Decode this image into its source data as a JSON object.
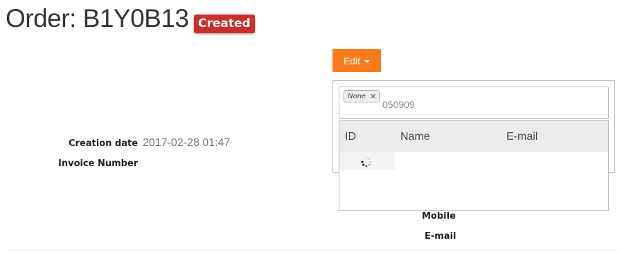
{
  "order": {
    "title": "Order: B1Y0B13",
    "status_badge": "Created",
    "status_color": "#c9302c"
  },
  "actions": {
    "edit_label": "Edit",
    "edit_color": "#f97b1d"
  },
  "customer_picker": {
    "selected_chip": "None",
    "chip_remove_icon": "close-icon",
    "search_value": "050909",
    "columns": [
      "ID",
      "Name",
      "E-mail"
    ],
    "loading_icon": "spinner-icon"
  },
  "details": {
    "creation_date_label": "Creation date",
    "creation_date_value": "2017-02-28 01:47",
    "invoice_number_label": "Invoice Number"
  },
  "contact": {
    "mobile_label": "Mobile",
    "email_label": "E-mail"
  }
}
